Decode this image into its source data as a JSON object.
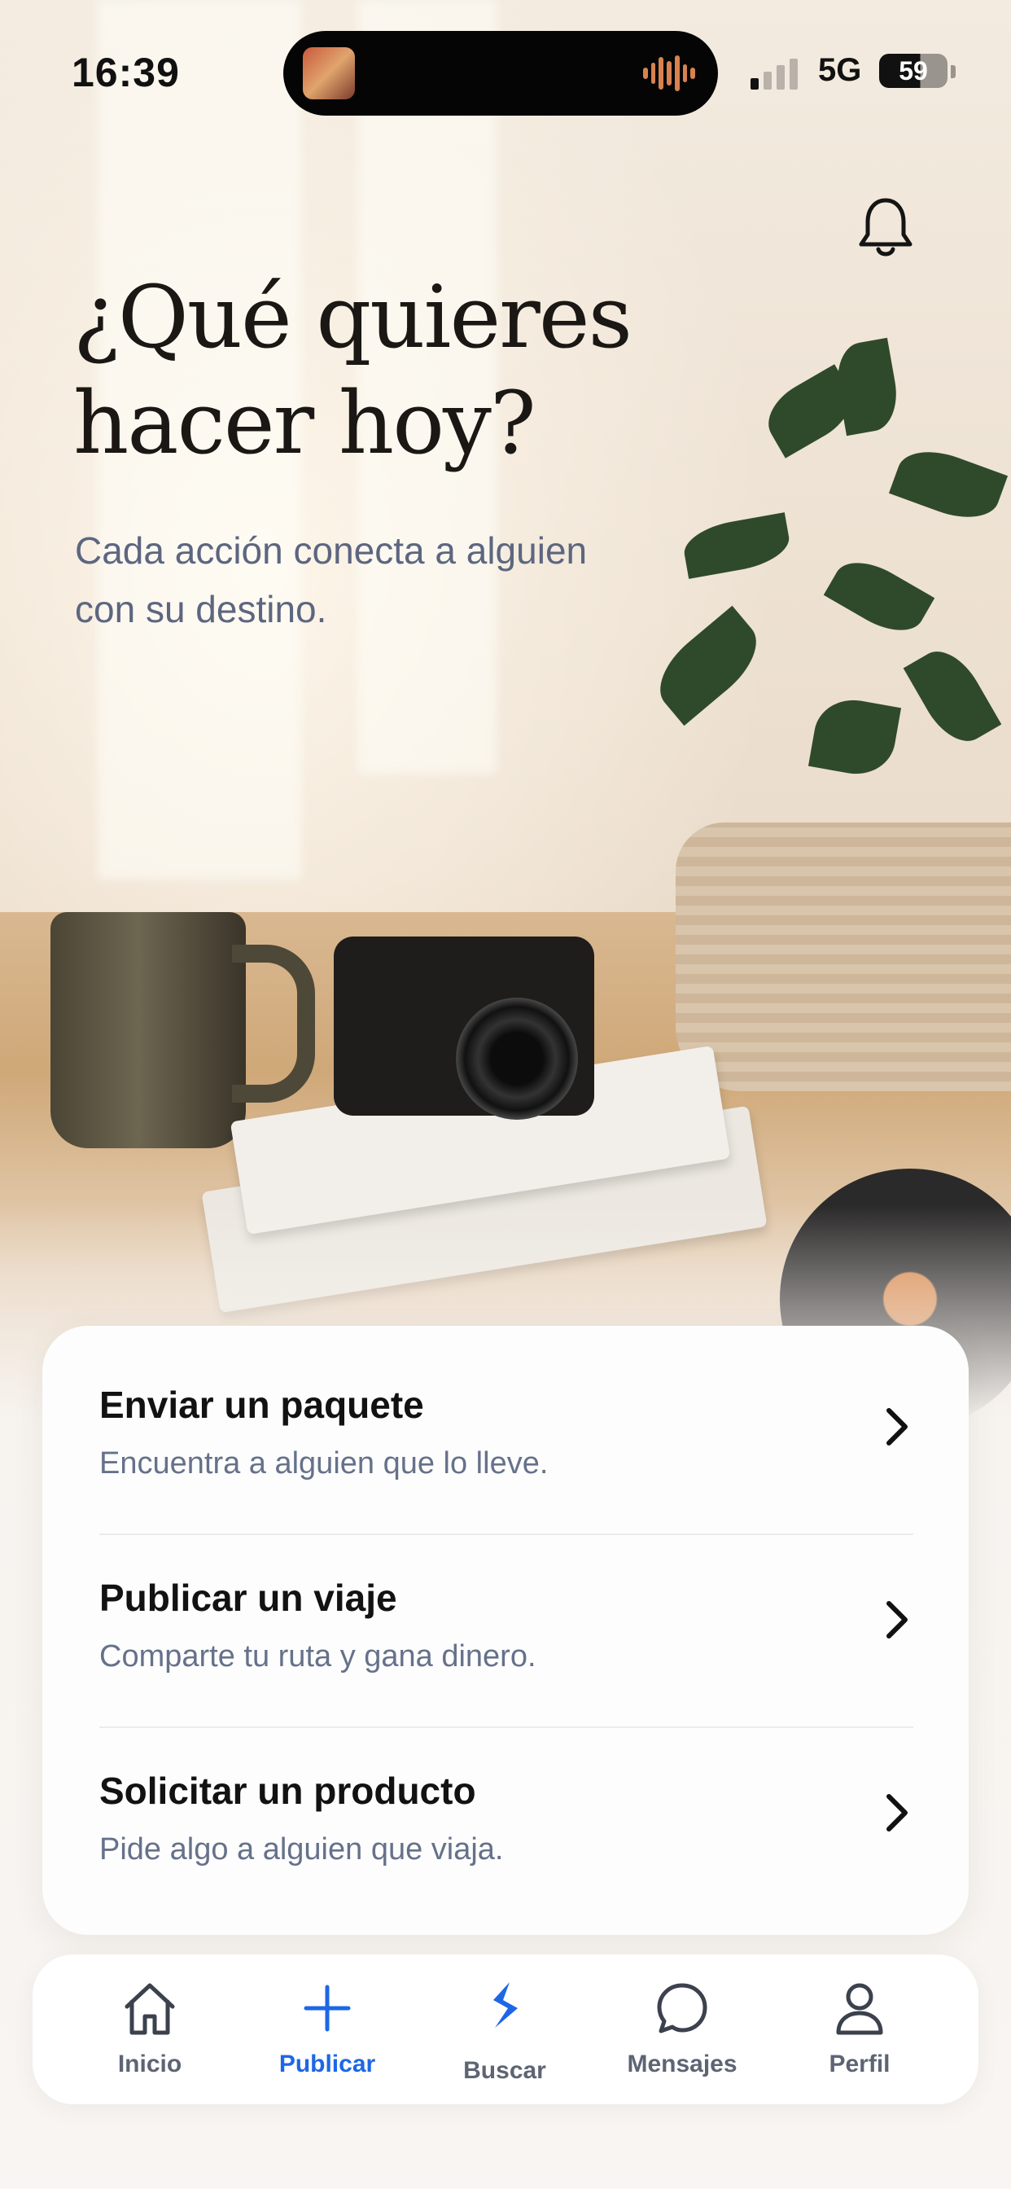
{
  "status_bar": {
    "time": "16:39",
    "network": "5G",
    "battery": "59"
  },
  "header": {
    "title": "¿Qué quieres hacer hoy?",
    "subtitle": "Cada acción conecta a alguien con su destino."
  },
  "actions": [
    {
      "title": "Enviar un paquete",
      "subtitle": "Encuentra a alguien que lo lleve."
    },
    {
      "title": "Publicar un viaje",
      "subtitle": "Comparte tu ruta y gana dinero."
    },
    {
      "title": "Solicitar un producto",
      "subtitle": "Pide algo a alguien que viaja."
    }
  ],
  "tabbar": {
    "items": [
      {
        "label": "Inicio",
        "icon": "home-icon"
      },
      {
        "label": "Publicar",
        "icon": "plus-icon",
        "active": true
      },
      {
        "label": "Buscar",
        "icon": "brand-logo-icon"
      },
      {
        "label": "Mensajes",
        "icon": "chat-bubble-icon"
      },
      {
        "label": "Perfil",
        "icon": "person-icon"
      }
    ]
  },
  "colors": {
    "accent": "#1d67e6",
    "title_text": "#1a1714",
    "subtitle_text": "#5d6680",
    "card_bg": "#fdfdfd",
    "muted_text": "#66718a"
  }
}
